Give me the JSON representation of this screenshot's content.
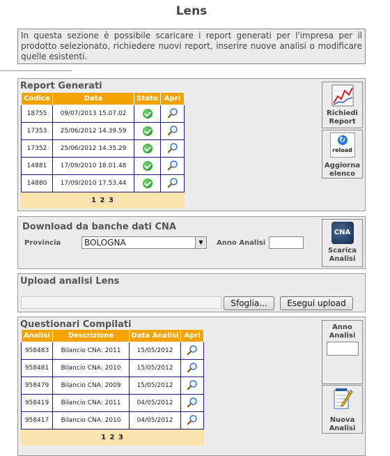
{
  "page_title": "Lens",
  "intro_text": "In questa sezione è possibile scaricare i report generati per l'impresa per il prodotto selezionato, richiedere nuovi report, inserire nuove analisi o modificare quelle esistenti.",
  "report_section": {
    "title": "Report Generati",
    "columns": [
      "Codice",
      "Data",
      "Stato",
      "Apri"
    ],
    "rows": [
      {
        "codice": "18755",
        "data": "09/07/2013 15.07.02"
      },
      {
        "codice": "17353",
        "data": "25/06/2012 14.39.59"
      },
      {
        "codice": "17352",
        "data": "25/06/2012 14.35.29"
      },
      {
        "codice": "14881",
        "data": "17/09/2010 18.01.48"
      },
      {
        "codice": "14880",
        "data": "17/09/2010 17.53.44"
      }
    ],
    "status_icon": "check-icon",
    "open_icon": "magnifier-icon",
    "pager": "1 2 3",
    "request_button": {
      "line1": "Richiedi",
      "line2": "Report",
      "icon": "report-chart-icon"
    },
    "reload_button": {
      "icon_text": "reload",
      "line1": "Aggiorna",
      "line2": "elenco",
      "icon": "reload-icon"
    }
  },
  "download_section": {
    "title": "Download da banche dati CNA",
    "provincia_label": "Provincia",
    "provincia_value": "BOLOGNA",
    "anno_label": "Anno Analisi",
    "anno_value": "",
    "download_button": {
      "logo_text": "CNA",
      "line1": "Scarica",
      "line2": "Analisi",
      "icon": "cna-logo-icon"
    }
  },
  "upload_section": {
    "title": "Upload analisi Lens",
    "file_value": "",
    "browse_label": "Sfoglia...",
    "upload_label": "Esegui upload"
  },
  "questionari_section": {
    "title": "Questionari Compilati",
    "columns": [
      "Analisi",
      "Descrizione",
      "Data Analisi",
      "Apri"
    ],
    "rows": [
      {
        "analisi": "958483",
        "descrizione": "Bilancio CNA: 2011",
        "data": "15/05/2012"
      },
      {
        "analisi": "958481",
        "descrizione": "Bilancio CNA: 2010",
        "data": "15/05/2012"
      },
      {
        "analisi": "958479",
        "descrizione": "Bilancio CNA: 2009",
        "data": "15/05/2012"
      },
      {
        "analisi": "958419",
        "descrizione": "Bilancio CNA: 2011",
        "data": "04/05/2012"
      },
      {
        "analisi": "958417",
        "descrizione": "Bilancio CNA: 2010",
        "data": "04/05/2012"
      }
    ],
    "pager": "1 2 3",
    "anno_label_line1": "Anno",
    "anno_label_line2": "Analisi",
    "anno_value": "",
    "new_button": {
      "line1": "Nuova",
      "line2": "Analisi",
      "icon": "notepad-pencil-icon"
    }
  },
  "colors": {
    "header_orange": "#f5a300",
    "panel_bg": "#ececec",
    "pager_bg": "#fbe3b0",
    "row_border": "#1a1a70"
  }
}
